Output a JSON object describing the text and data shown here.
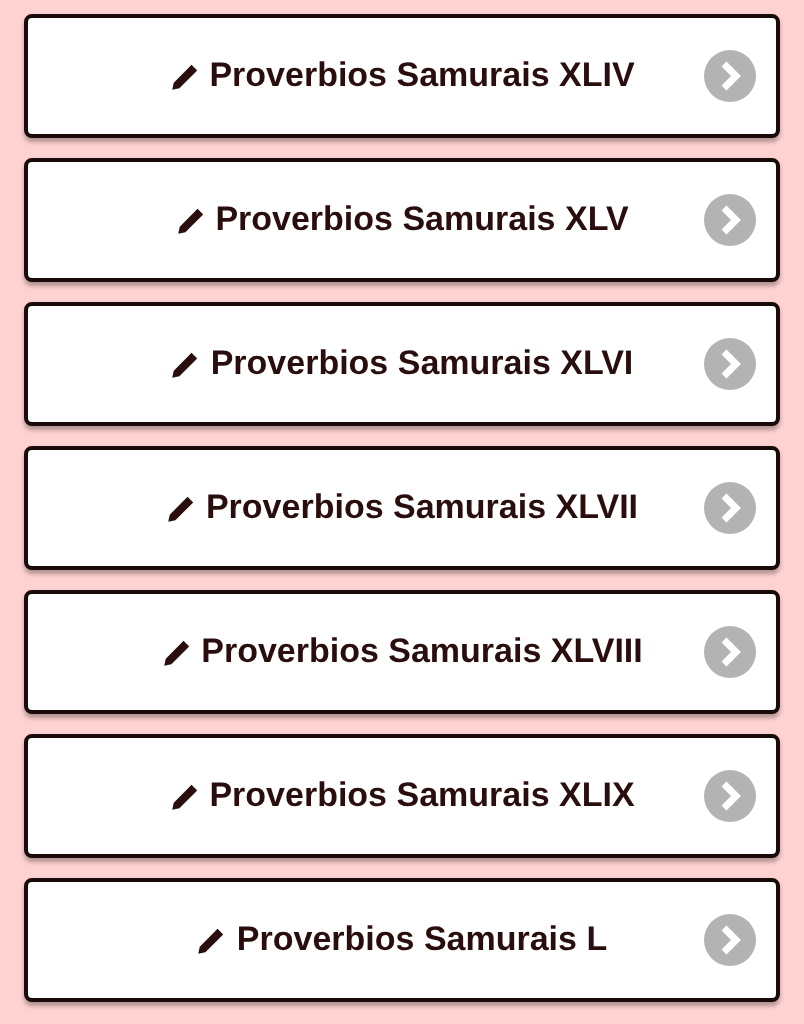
{
  "items": [
    {
      "label": "Proverbios Samurais XLIV"
    },
    {
      "label": "Proverbios Samurais XLV"
    },
    {
      "label": "Proverbios Samurais XLVI"
    },
    {
      "label": "Proverbios Samurais XLVII"
    },
    {
      "label": "Proverbios Samurais XLVIII"
    },
    {
      "label": "Proverbios Samurais XLIX"
    },
    {
      "label": "Proverbios Samurais L"
    }
  ]
}
